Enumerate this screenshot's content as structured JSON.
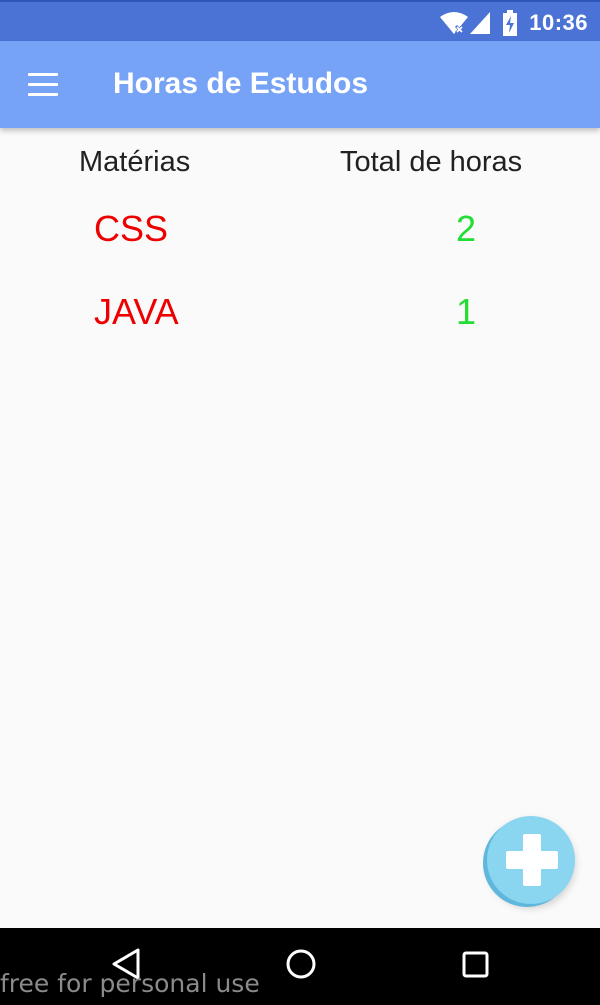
{
  "status_bar": {
    "time": "10:36",
    "icons": [
      "wifi-icon",
      "signal-icon",
      "battery-charging-icon"
    ]
  },
  "app_bar": {
    "title": "Horas de Estudos",
    "menu_icon": "menu-icon"
  },
  "table": {
    "headers": {
      "subject": "Matérias",
      "hours": "Total de horas"
    },
    "rows": [
      {
        "subject": "CSS",
        "hours": "2"
      },
      {
        "subject": "JAVA",
        "hours": "1"
      }
    ]
  },
  "fab": {
    "icon": "plus-icon"
  },
  "nav_bar": {
    "icons": [
      "back-icon",
      "home-icon",
      "recents-icon"
    ]
  },
  "watermark": "free for personal use",
  "colors": {
    "status_bar": "#4b73d6",
    "app_bar": "#76a3f5",
    "subject_text": "#ee0000",
    "hours_text": "#22dd33",
    "fab": "#8ad5f0",
    "nav_bar": "#000000",
    "background": "#fafafa"
  }
}
